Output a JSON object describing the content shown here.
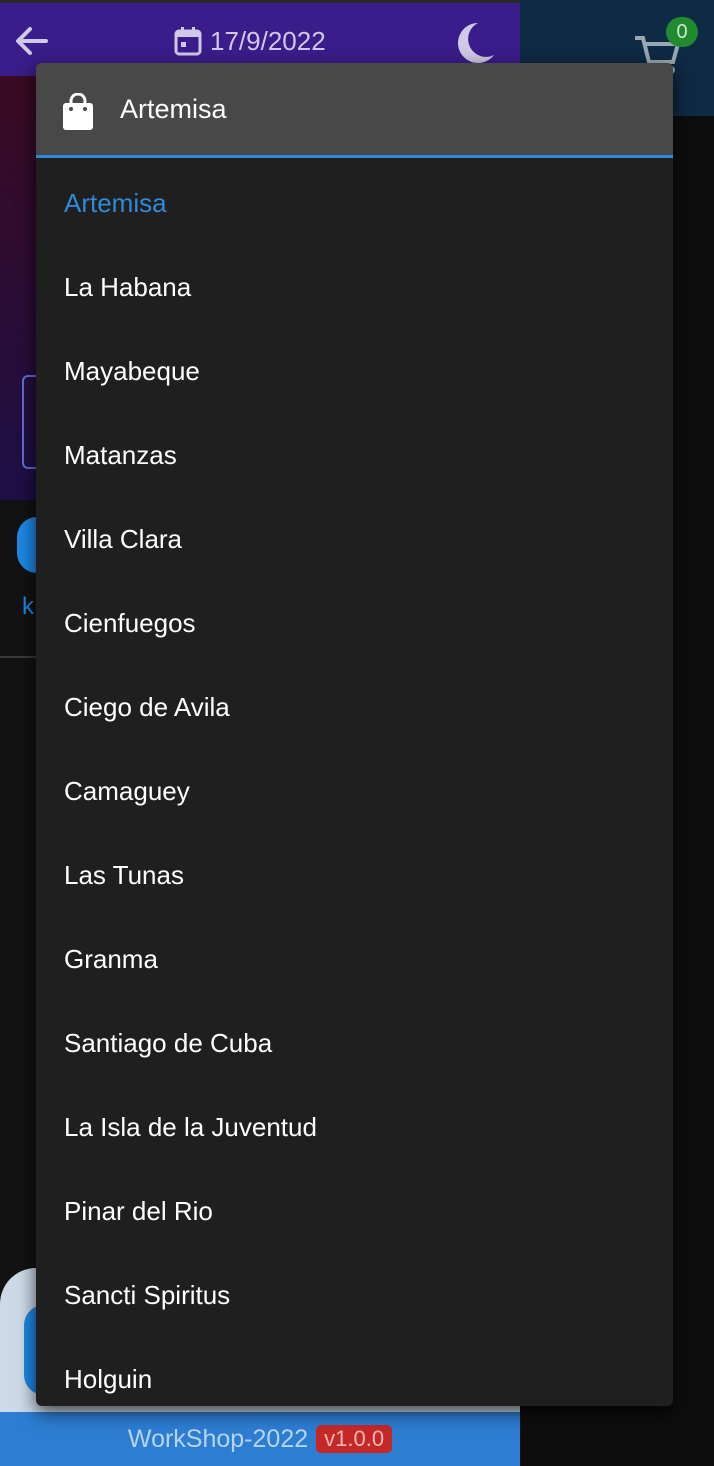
{
  "appbar": {
    "date": "17/9/2022",
    "cart_count": "0"
  },
  "background": {
    "peek_letter": "k"
  },
  "footer": {
    "label": "WorkShop-2022",
    "version": "v1.0.0"
  },
  "dropdown": {
    "selected": "Artemisa",
    "items": [
      "Artemisa",
      "La Habana",
      "Mayabeque",
      "Matanzas",
      "Villa Clara",
      "Cienfuegos",
      "Ciego de Avila",
      "Camaguey",
      "Las Tunas",
      "Granma",
      "Santiago de Cuba",
      "La Isla de la Juventud",
      "Pinar del Rio",
      "Sancti Spiritus",
      "Holguin"
    ]
  },
  "colors": {
    "appbar": "#3a1d8a",
    "accent": "#2f8ad8",
    "menu_bg": "#1f1f1f",
    "header_bg": "#484848",
    "badge_green": "#1f8a2e",
    "version_red": "#c62828"
  },
  "icons": {
    "back": "arrow-left-icon",
    "calendar": "calendar-icon",
    "theme": "moon-icon",
    "cart": "cart-icon",
    "header": "shopping-bag-icon"
  }
}
